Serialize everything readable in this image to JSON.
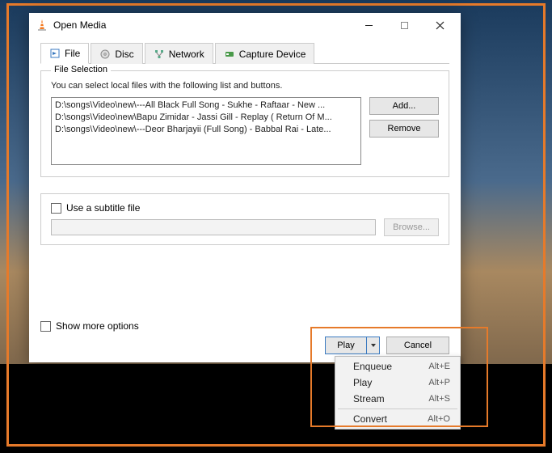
{
  "window": {
    "title": "Open Media",
    "tabs": [
      {
        "label": "File"
      },
      {
        "label": "Disc"
      },
      {
        "label": "Network"
      },
      {
        "label": "Capture Device"
      }
    ]
  },
  "fileSelection": {
    "legend": "File Selection",
    "hint": "You can select local files with the following list and buttons.",
    "files": [
      "D:\\songs\\Video\\new\\---All Black Full Song - Sukhe - Raftaar -  New ...",
      "D:\\songs\\Video\\new\\Bapu Zimidar - Jassi Gill - Replay ( Return Of M...",
      "D:\\songs\\Video\\new\\---Deor Bharjayii (Full Song) - Babbal Rai - Late..."
    ],
    "addLabel": "Add...",
    "removeLabel": "Remove"
  },
  "subtitle": {
    "label": "Use a subtitle file",
    "browse": "Browse..."
  },
  "showMore": "Show more options",
  "actions": {
    "play": "Play",
    "cancel": "Cancel"
  },
  "menu": [
    {
      "label": "Enqueue",
      "shortcut": "Alt+E"
    },
    {
      "label": "Play",
      "shortcut": "Alt+P"
    },
    {
      "label": "Stream",
      "shortcut": "Alt+S"
    },
    {
      "label": "Convert",
      "shortcut": "Alt+O"
    }
  ]
}
